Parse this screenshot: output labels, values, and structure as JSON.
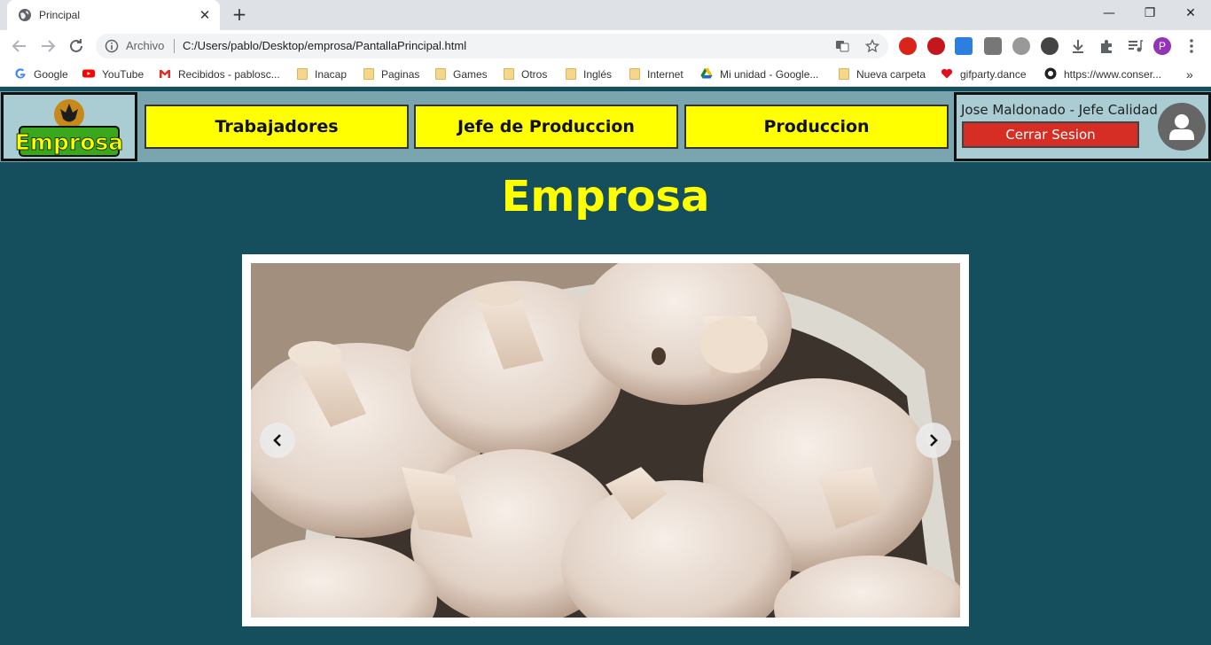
{
  "browser": {
    "tab_title": "Principal",
    "new_tab_symbol": "+",
    "close_symbol": "✕",
    "address_prefix": "Archivo",
    "url": "C:/Users/pablo/Desktop/emprosa/PantallaPrincipal.html",
    "window_controls": {
      "minimize": "—",
      "restore": "❐",
      "close": "✕"
    }
  },
  "bookmarks": [
    {
      "label": "Google",
      "icon": "google-icon"
    },
    {
      "label": "YouTube",
      "icon": "youtube-icon"
    },
    {
      "label": "Recibidos - pablosc...",
      "icon": "gmail-icon"
    },
    {
      "label": "Inacap",
      "icon": "folder-icon"
    },
    {
      "label": "Paginas",
      "icon": "folder-icon"
    },
    {
      "label": "Games",
      "icon": "folder-icon"
    },
    {
      "label": "Otros",
      "icon": "folder-icon"
    },
    {
      "label": "Inglés",
      "icon": "folder-icon"
    },
    {
      "label": "Internet",
      "icon": "folder-icon"
    },
    {
      "label": "Mi unidad - Google...",
      "icon": "drive-icon"
    },
    {
      "label": "Nueva carpeta",
      "icon": "folder-icon"
    },
    {
      "label": "gifparty.dance",
      "icon": "heart-icon"
    },
    {
      "label": "https://www.conser...",
      "icon": "site-icon"
    }
  ],
  "bookmarks_overflow": "»",
  "navbar": {
    "logo_text": "Emprosa",
    "items": [
      "Trabajadores",
      "Jefe de Produccion",
      "Produccion"
    ],
    "user_name": "Jose Maldonado - Jefe Calidad",
    "logout_label": "Cerrar Sesion"
  },
  "main": {
    "title": "Emprosa"
  },
  "colors": {
    "page_bg": "#154e5c",
    "navbar_bg": "#7aa5ae",
    "nav_button": "#ffff00",
    "title": "#ffff00",
    "logout": "#d62d24"
  }
}
